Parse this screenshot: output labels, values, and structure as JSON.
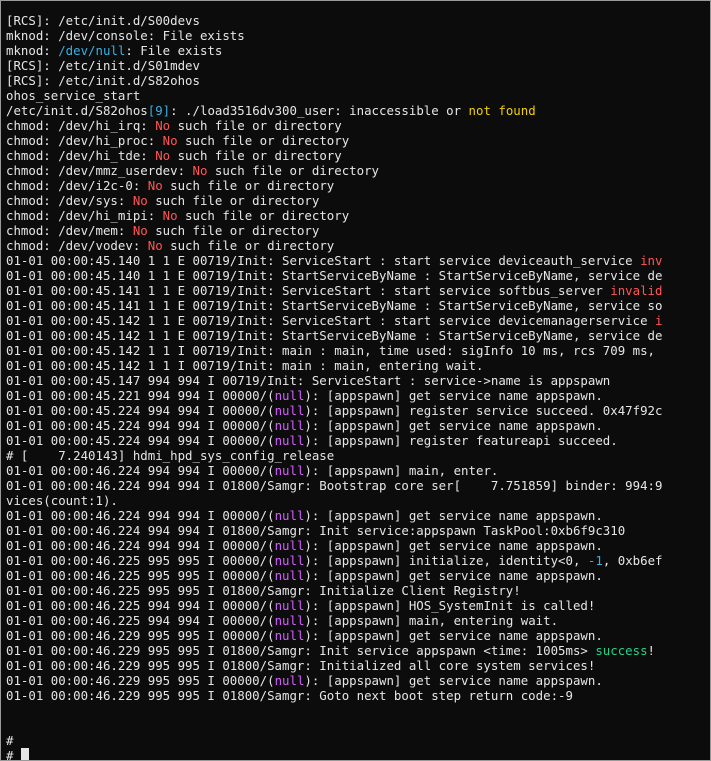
{
  "terminal": {
    "colors": {
      "background": "#0c0c0c",
      "text": "#e6e6e6",
      "red": "#ff5555",
      "yellow": "#f0d000",
      "magenta": "#d35cff",
      "cyan": "#3ab0e2",
      "green": "#23d18b"
    },
    "lines": [
      [
        {
          "t": "[RCS]: /etc/init.d/S00devs"
        }
      ],
      [
        {
          "t": "mknod: /dev/console: File exists"
        }
      ],
      [
        {
          "t": "mknod: "
        },
        {
          "t": "/dev/null",
          "c": "cyan"
        },
        {
          "t": ": File exists"
        }
      ],
      [
        {
          "t": "[RCS]: /etc/init.d/S01mdev"
        }
      ],
      [
        {
          "t": "[RCS]: /etc/init.d/S82ohos"
        }
      ],
      [
        {
          "t": "ohos_service_start"
        }
      ],
      [
        {
          "t": "/etc/init.d/S82ohos"
        },
        {
          "t": "[9]",
          "c": "cyan"
        },
        {
          "t": ": ./load3516dv300_user: inaccessible or "
        },
        {
          "t": "not found",
          "c": "yellow"
        }
      ],
      [
        {
          "t": "chmod: /dev/hi_irq: "
        },
        {
          "t": "No",
          "c": "red"
        },
        {
          "t": " such file or directory"
        }
      ],
      [
        {
          "t": "chmod: /dev/hi_proc: "
        },
        {
          "t": "No",
          "c": "red"
        },
        {
          "t": " such file or directory"
        }
      ],
      [
        {
          "t": "chmod: /dev/hi_tde: "
        },
        {
          "t": "No",
          "c": "red"
        },
        {
          "t": " such file or directory"
        }
      ],
      [
        {
          "t": "chmod: /dev/mmz_userdev: "
        },
        {
          "t": "No",
          "c": "red"
        },
        {
          "t": " such file or directory"
        }
      ],
      [
        {
          "t": "chmod: /dev/i2c-0: "
        },
        {
          "t": "No",
          "c": "red"
        },
        {
          "t": " such file or directory"
        }
      ],
      [
        {
          "t": "chmod: /dev/sys: "
        },
        {
          "t": "No",
          "c": "red"
        },
        {
          "t": " such file or directory"
        }
      ],
      [
        {
          "t": "chmod: /dev/hi_mipi: "
        },
        {
          "t": "No",
          "c": "red"
        },
        {
          "t": " such file or directory"
        }
      ],
      [
        {
          "t": "chmod: /dev/mem: "
        },
        {
          "t": "No",
          "c": "red"
        },
        {
          "t": " such file or directory"
        }
      ],
      [
        {
          "t": "chmod: /dev/vodev: "
        },
        {
          "t": "No",
          "c": "red"
        },
        {
          "t": " such file or directory"
        }
      ],
      [
        {
          "t": "01-01 00:00:45.140 1 1 E 00719/Init: ServiceStart : start service deviceauth_service "
        },
        {
          "t": "inv",
          "c": "red"
        }
      ],
      [
        {
          "t": "01-01 00:00:45.140 1 1 E 00719/Init: StartServiceByName : StartServiceByName, service de"
        }
      ],
      [
        {
          "t": "01-01 00:00:45.141 1 1 E 00719/Init: ServiceStart : start service softbus_server "
        },
        {
          "t": "invalid",
          "c": "red"
        }
      ],
      [
        {
          "t": "01-01 00:00:45.141 1 1 E 00719/Init: StartServiceByName : StartServiceByName, service so"
        }
      ],
      [
        {
          "t": "01-01 00:00:45.142 1 1 E 00719/Init: ServiceStart : start service devicemanagerservice "
        },
        {
          "t": "i",
          "c": "red"
        }
      ],
      [
        {
          "t": "01-01 00:00:45.142 1 1 E 00719/Init: StartServiceByName : StartServiceByName, service de"
        }
      ],
      [
        {
          "t": "01-01 00:00:45.142 1 1 I 00719/Init: main : main, time used: sigInfo 10 ms, rcs 709 ms,"
        }
      ],
      [
        {
          "t": "01-01 00:00:45.142 1 1 I 00719/Init: main : main, entering wait."
        }
      ],
      [
        {
          "t": "01-01 00:00:45.147 994 994 I 00719/Init: ServiceStart : service->name is appspawn"
        }
      ],
      [
        {
          "t": "01-01 00:00:45.221 994 994 I 00000/("
        },
        {
          "t": "null",
          "c": "magenta"
        },
        {
          "t": "): [appspawn] get service name appspawn."
        }
      ],
      [
        {
          "t": "01-01 00:00:45.224 994 994 I 00000/("
        },
        {
          "t": "null",
          "c": "magenta"
        },
        {
          "t": "): [appspawn] register service succeed. 0x47f92c"
        }
      ],
      [
        {
          "t": "01-01 00:00:45.224 994 994 I 00000/("
        },
        {
          "t": "null",
          "c": "magenta"
        },
        {
          "t": "): [appspawn] get service name appspawn."
        }
      ],
      [
        {
          "t": "01-01 00:00:45.224 994 994 I 00000/("
        },
        {
          "t": "null",
          "c": "magenta"
        },
        {
          "t": "): [appspawn] register featureapi succeed."
        }
      ],
      [
        {
          "t": "# [    7.240143] hdmi_hpd_sys_config_release"
        }
      ],
      [
        {
          "t": "01-01 00:00:46.224 994 994 I 00000/("
        },
        {
          "t": "null",
          "c": "magenta"
        },
        {
          "t": "): [appspawn] main, enter."
        }
      ],
      [
        {
          "t": "01-01 00:00:46.224 994 994 I 01800/Samgr: Bootstrap core ser[    7.751859] binder: 994:9"
        }
      ],
      [
        {
          "t": "vices(count:1)."
        }
      ],
      [
        {
          "t": "01-01 00:00:46.224 994 994 I 00000/("
        },
        {
          "t": "null",
          "c": "magenta"
        },
        {
          "t": "): [appspawn] get service name appspawn."
        }
      ],
      [
        {
          "t": "01-01 00:00:46.224 994 994 I 01800/Samgr: Init service:appspawn TaskPool:0xb6f9c310"
        }
      ],
      [
        {
          "t": "01-01 00:00:46.224 994 994 I 00000/("
        },
        {
          "t": "null",
          "c": "magenta"
        },
        {
          "t": "): [appspawn] get service name appspawn."
        }
      ],
      [
        {
          "t": "01-01 00:00:46.225 995 995 I 00000/("
        },
        {
          "t": "null",
          "c": "magenta"
        },
        {
          "t": "): [appspawn] initialize, identity<0, "
        },
        {
          "t": "-1",
          "c": "cyan"
        },
        {
          "t": ", 0xb6ef"
        }
      ],
      [
        {
          "t": "01-01 00:00:46.225 995 995 I 00000/("
        },
        {
          "t": "null",
          "c": "magenta"
        },
        {
          "t": "): [appspawn] get service name appspawn."
        }
      ],
      [
        {
          "t": "01-01 00:00:46.225 995 995 I 01800/Samgr: Initialize Client Registry!"
        }
      ],
      [
        {
          "t": "01-01 00:00:46.225 994 994 I 00000/("
        },
        {
          "t": "null",
          "c": "magenta"
        },
        {
          "t": "): [appspawn] HOS_SystemInit is called!"
        }
      ],
      [
        {
          "t": "01-01 00:00:46.225 994 994 I 00000/("
        },
        {
          "t": "null",
          "c": "magenta"
        },
        {
          "t": "): [appspawn] main, entering wait."
        }
      ],
      [
        {
          "t": "01-01 00:00:46.229 995 995 I 00000/("
        },
        {
          "t": "null",
          "c": "magenta"
        },
        {
          "t": "): [appspawn] get service name appspawn."
        }
      ],
      [
        {
          "t": "01-01 00:00:46.229 995 995 I 01800/Samgr: Init service appspawn <time: 1005ms> "
        },
        {
          "t": "success",
          "c": "green"
        },
        {
          "t": "!"
        }
      ],
      [
        {
          "t": "01-01 00:00:46.229 995 995 I 01800/Samgr: Initialized all core system services!"
        }
      ],
      [
        {
          "t": "01-01 00:00:46.229 995 995 I 00000/("
        },
        {
          "t": "null",
          "c": "magenta"
        },
        {
          "t": "): [appspawn] get service name appspawn."
        }
      ],
      [
        {
          "t": "01-01 00:00:46.229 995 995 I 01800/Samgr: Goto next boot step return code:-9"
        }
      ],
      [
        {
          "t": ""
        }
      ],
      [
        {
          "t": ""
        }
      ],
      [
        {
          "t": "#"
        }
      ],
      [
        {
          "t": "# "
        },
        {
          "cursor": true
        }
      ]
    ]
  }
}
